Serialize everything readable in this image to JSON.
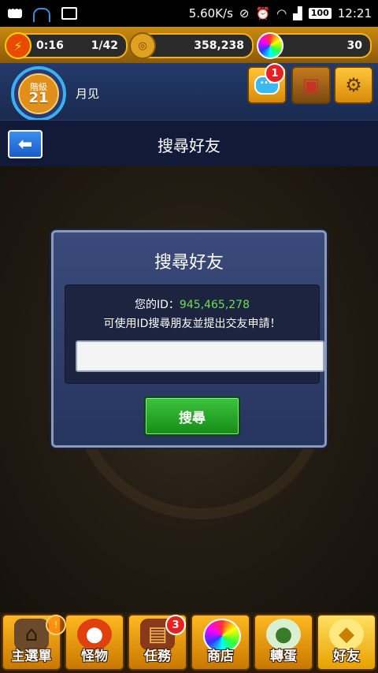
{
  "status_bar": {
    "net_speed": "5.60K/s",
    "battery": "100",
    "time": "12:21"
  },
  "resources": {
    "stamina_timer": "0:16",
    "stamina": "1/42",
    "coins": "358,238",
    "orbs": "30"
  },
  "player": {
    "rank_label": "階級",
    "rank": "21",
    "name": "月见"
  },
  "header": {
    "chat_badge": "1",
    "title": "搜尋好友"
  },
  "dialog": {
    "title": "搜尋好友",
    "id_label": "您的ID：",
    "id_value": "945,465,278",
    "hint": "可使用ID搜尋朋友並提出交友申請！",
    "input_value": "",
    "search_button": "搜尋"
  },
  "bottom_nav": {
    "items": [
      {
        "label": "主選單",
        "icon": "home-icon"
      },
      {
        "label": "怪物",
        "icon": "monster-icon"
      },
      {
        "label": "任務",
        "icon": "quest-book-icon",
        "badge": "3"
      },
      {
        "label": "商店",
        "icon": "orb-shop-icon"
      },
      {
        "label": "轉蛋",
        "icon": "egg-icon"
      },
      {
        "label": "好友",
        "icon": "friends-icon"
      }
    ]
  },
  "colors": {
    "accent_gold": "#f0b020",
    "id_green": "#6ce050",
    "button_green": "#3cc43c",
    "navy": "#111a38"
  }
}
